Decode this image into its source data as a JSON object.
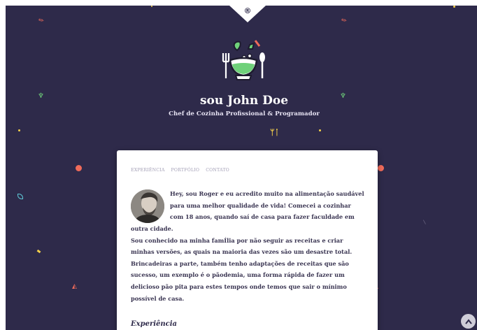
{
  "brand": {
    "mark": "®"
  },
  "header": {
    "title": "sou John Doe",
    "subtitle": "Chef de Cozinha Profissional & Programador"
  },
  "nav": [
    {
      "label": "EXPERIÊNCIA"
    },
    {
      "label": "PORTFÓLIO"
    },
    {
      "label": "CONTATO"
    }
  ],
  "bio": {
    "first_lines": [
      "Hey, sou Roger e eu acredito muito na alimentação saudável",
      "para uma melhor qualidade de vida! Comecei a cozinhar",
      "com 18 anos, quando saí de casa para fazer faculdade em"
    ],
    "rest_lines": [
      "outra cidade.",
      "Sou conhecido na minha famÍlia por não seguir as receitas e criar",
      "minhas versões, as quais na maioria das vezes são um desastre total.",
      "Brincadeiras a parte, também tenho adaptações de receitas que são",
      "sucesso, um exemplo é o pãodemia, uma forma rápida de fazer um",
      "delicioso pão pita para estes tempos onde temos que sair o mínimo",
      "possível de casa."
    ]
  },
  "sections": {
    "experience_heading": "Experiência"
  },
  "colors": {
    "background": "#2e2a4a",
    "card": "#ffffff",
    "accent_green": "#6fd17a",
    "accent_red": "#f06b5a",
    "accent_yellow": "#f7d24a"
  },
  "icons": {
    "logo": "salad-bowl-logo-icon",
    "fork_knife": "fork-knife-icon",
    "scroll_top": "chevron-up-icon"
  }
}
